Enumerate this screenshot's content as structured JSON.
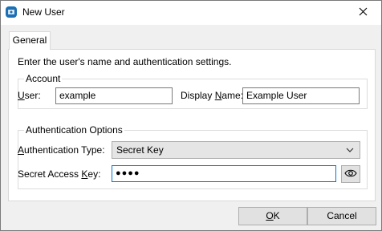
{
  "window": {
    "title": "New User"
  },
  "tabs": [
    {
      "label": "General"
    }
  ],
  "intro_text": "Enter the user's name and authentication settings.",
  "account": {
    "group_label": "Account",
    "user_label_key": "U",
    "user_label_rest": "ser:",
    "user_value": "example",
    "display_label_pre": "Display ",
    "display_label_key": "N",
    "display_label_rest": "ame:",
    "display_value": "Example User"
  },
  "auth": {
    "group_label": "Authentication Options",
    "type_label_key": "A",
    "type_label_rest": "uthentication Type:",
    "type_value": "Secret Key",
    "secret_label_pre": "Secret Access ",
    "secret_label_key": "K",
    "secret_label_rest": "ey:",
    "secret_value": "●●●●"
  },
  "buttons": {
    "ok_key": "O",
    "ok_rest": "K",
    "cancel_label": "Cancel"
  },
  "colors": {
    "focus_border": "#0078d7",
    "app_icon": "#1b6fb5"
  },
  "icons": {
    "app": "app-logo-icon",
    "close": "close-icon",
    "reveal": "eye-icon",
    "dropdown": "chevron-down-icon"
  }
}
